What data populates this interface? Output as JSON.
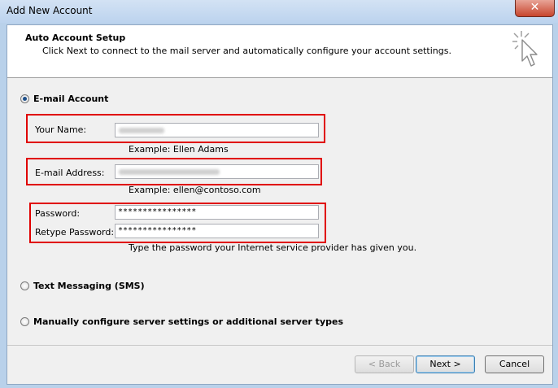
{
  "window": {
    "title": "Add New Account",
    "close_label": "✕"
  },
  "header": {
    "title": "Auto Account Setup",
    "description": "Click Next to connect to the mail server and automatically configure your account settings."
  },
  "email_account": {
    "label": "E-mail Account",
    "your_name": {
      "label": "Your Name:",
      "hint": "Example: Ellen Adams"
    },
    "email_address": {
      "label": "E-mail Address:",
      "hint": "Example: ellen@contoso.com"
    },
    "password": {
      "label": "Password:",
      "value": "****************"
    },
    "retype_password": {
      "label": "Retype Password:",
      "value": "****************"
    },
    "password_hint": "Type the password your Internet service provider has given you."
  },
  "text_messaging": {
    "label": "Text Messaging (SMS)"
  },
  "manual_config": {
    "label": "Manually configure server settings or additional server types"
  },
  "buttons": {
    "back": "< Back",
    "next": "Next >",
    "cancel": "Cancel"
  },
  "colors": {
    "highlight": "#e00000",
    "titlebar": "#bcd3ee",
    "close": "#c7452d"
  }
}
